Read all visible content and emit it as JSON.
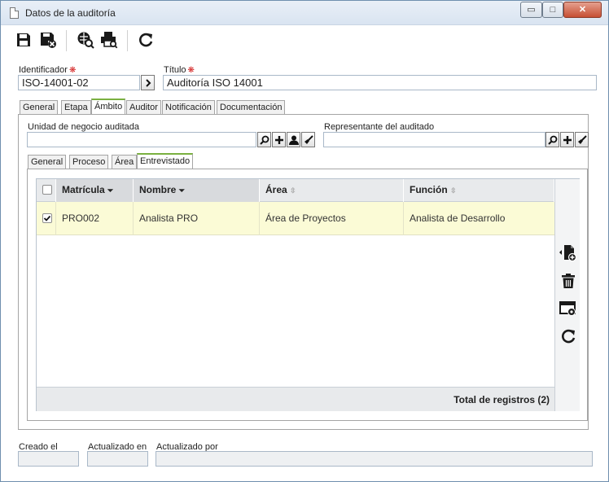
{
  "window": {
    "title": "Datos de la auditoría",
    "controls": {
      "minimize": "▭",
      "maximize": "□",
      "close": "✕"
    }
  },
  "toolbar": {
    "icons": [
      "save-icon",
      "save-close-icon",
      "view-report-icon",
      "print-icon",
      "refresh-icon"
    ]
  },
  "form": {
    "identifier_label": "Identificador",
    "identifier_value": "ISO-14001-02",
    "title_label": "Título",
    "title_value": "Auditoría ISO 14001",
    "required_mark": "❋"
  },
  "tabs": [
    "General",
    "Etapa",
    "Ámbito",
    "Auditor",
    "Notificación",
    "Documentación"
  ],
  "active_tab": "Ámbito",
  "scope": {
    "unit_label": "Unidad de negocio auditada",
    "unit_value": "",
    "representative_label": "Representante del auditado",
    "representative_value": ""
  },
  "subtabs": [
    "General",
    "Proceso",
    "Área",
    "Entrevistado"
  ],
  "active_subtab": "Entrevistado",
  "grid": {
    "columns": [
      "Matrícula",
      "Nombre",
      "Área",
      "Función"
    ],
    "sort_down": "⏷",
    "sort_neutral": "⇳",
    "rows": [
      {
        "matricula": "PRO002",
        "nombre": "Analista PRO",
        "area": "Área de Proyectos",
        "funcion": "Analista de Desarrollo",
        "checked": true
      }
    ],
    "footer": "Total de registros (2)"
  },
  "footer_fields": {
    "created_label": "Creado el",
    "created_value": "",
    "updated_label": "Actualizado en",
    "updated_value": "",
    "updated_by_label": "Actualizado por",
    "updated_by_value": ""
  }
}
